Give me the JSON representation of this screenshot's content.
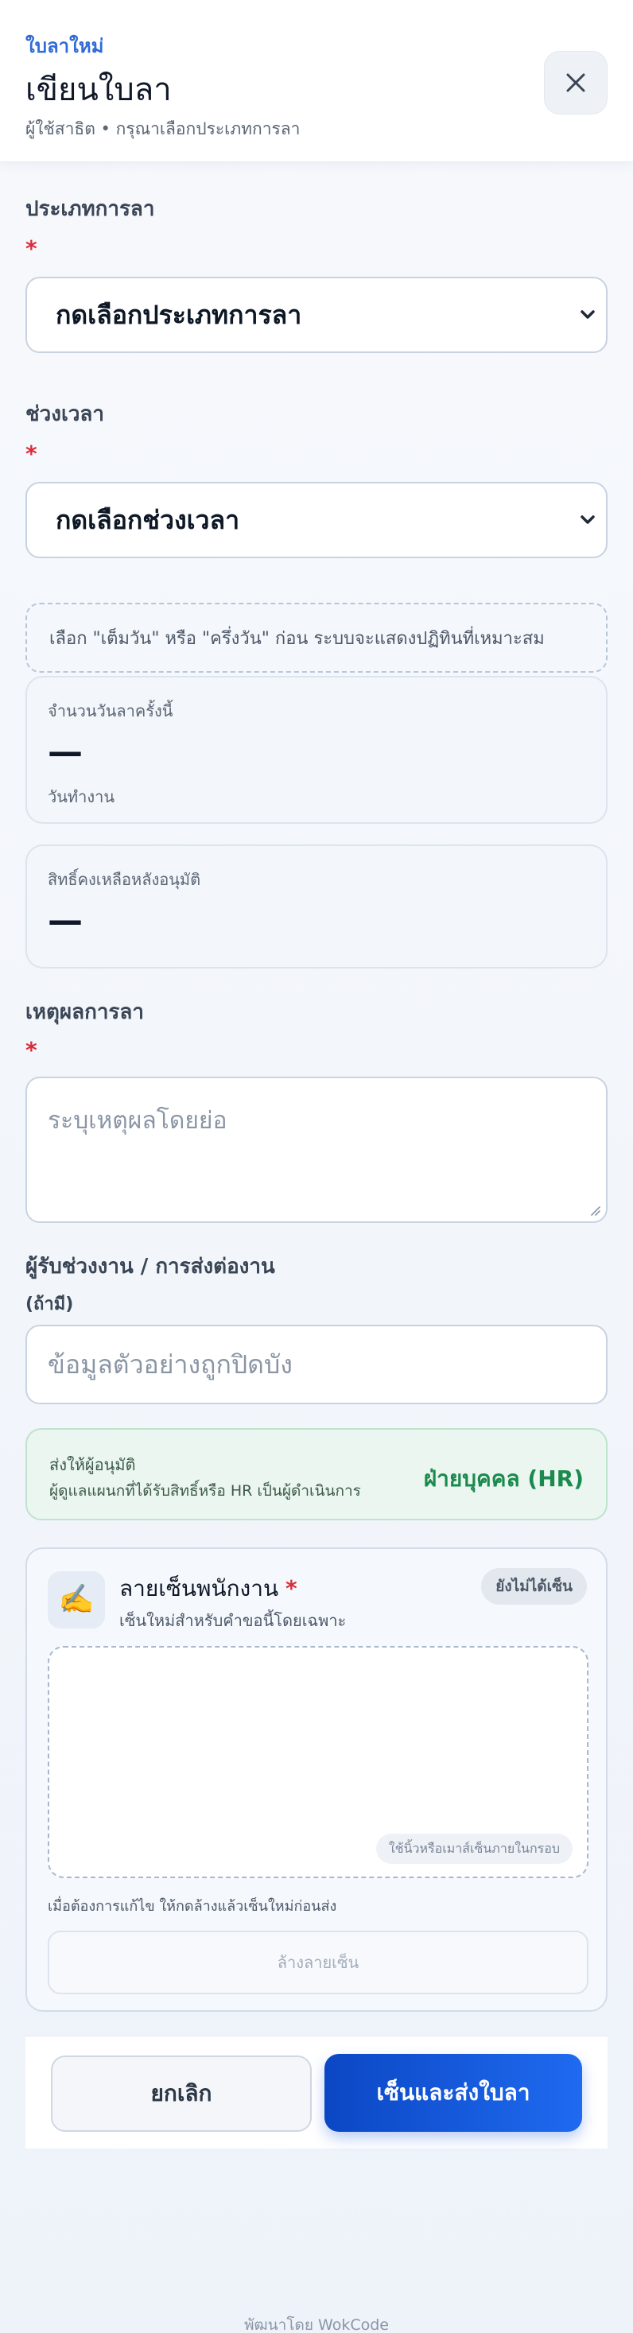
{
  "header": {
    "kicker": "ใบลาใหม่",
    "title": "เขียนใบลา",
    "subtitle": "ผู้ใช้สาธิต • กรุณาเลือกประเภทการลา"
  },
  "form": {
    "leave_type": {
      "label": "ประเภทการลา",
      "required_mark": "*",
      "selected": "กดเลือกประเภทการลา"
    },
    "period": {
      "label": "ช่วงเวลา",
      "required_mark": "*",
      "selected": "กดเลือกช่วงเวลา"
    },
    "period_hint": "เลือก \"เต็มวัน\" หรือ \"ครึ่งวัน\" ก่อน ระบบจะแสดงปฏิทินที่เหมาะสม",
    "days_card": {
      "label": "จำนวนวันลาครั้งนี้",
      "value": "—",
      "unit": "วันทำงาน"
    },
    "remaining_card": {
      "label": "สิทธิ์คงเหลือหลังอนุมัติ",
      "value": "—"
    },
    "reason": {
      "label": "เหตุผลการลา",
      "required_mark": "*",
      "placeholder": "ระบุเหตุผลโดยย่อ"
    },
    "handover": {
      "label": "ผู้รับช่วงงาน / การส่งต่องาน",
      "sublabel": "(ถ้ามี)",
      "placeholder": "ข้อมูลตัวอย่างถูกปิดบัง"
    },
    "approver": {
      "label": "ส่งให้ผู้อนุมัติ",
      "description": "ผู้ดูแลแผนกที่ได้รับสิทธิ์หรือ HR เป็นผู้ดำเนินการ",
      "value": "ฝ่ายบุคคล (HR)"
    },
    "signature": {
      "icon": "✍️",
      "title": "ลายเซ็นพนักงาน",
      "required_mark": "*",
      "subtitle": "เซ็นใหม่สำหรับคำขอนี้โดยเฉพาะ",
      "status_badge": "ยังไม่ได้เซ็น",
      "pad_hint": "ใช้นิ้วหรือเมาส์เซ็นภายในกรอบ",
      "note": "เมื่อต้องการแก้ไข ให้กดล้างแล้วเซ็นใหม่ก่อนส่ง",
      "clear_label": "ล้างลายเซ็น"
    }
  },
  "actions": {
    "cancel_label": "ยกเลิก",
    "submit_label": "เซ็นและส่งใบลา"
  },
  "footer": {
    "powered_by": "พัฒนาโดย WokCode"
  },
  "colors": {
    "accent": "#2f6bd9",
    "required": "#d92d3b",
    "success": "#1b8a4e",
    "primary_button": "#1f6af0"
  }
}
